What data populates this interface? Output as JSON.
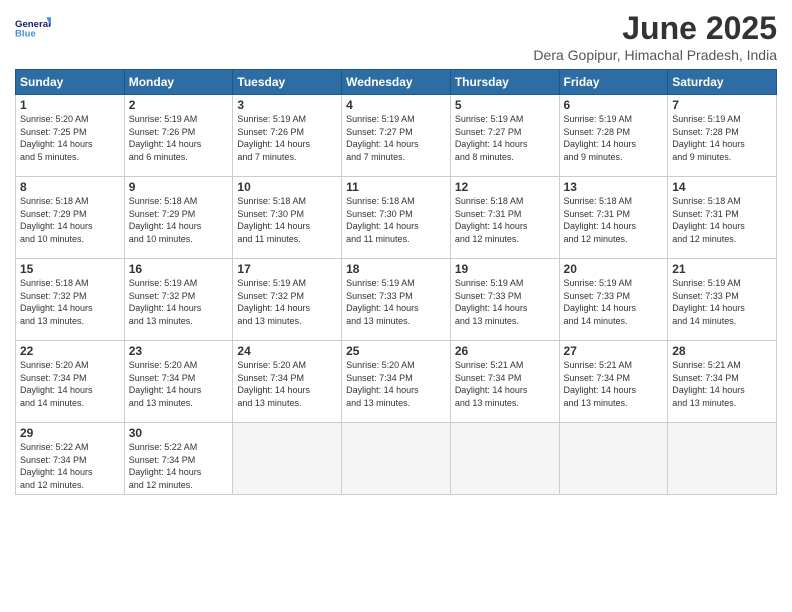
{
  "logo": {
    "line1": "General",
    "line2": "Blue"
  },
  "title": "June 2025",
  "subtitle": "Dera Gopipur, Himachal Pradesh, India",
  "weekdays": [
    "Sunday",
    "Monday",
    "Tuesday",
    "Wednesday",
    "Thursday",
    "Friday",
    "Saturday"
  ],
  "weeks": [
    [
      {
        "day": 1,
        "info": "Sunrise: 5:20 AM\nSunset: 7:25 PM\nDaylight: 14 hours\nand 5 minutes."
      },
      {
        "day": 2,
        "info": "Sunrise: 5:19 AM\nSunset: 7:26 PM\nDaylight: 14 hours\nand 6 minutes."
      },
      {
        "day": 3,
        "info": "Sunrise: 5:19 AM\nSunset: 7:26 PM\nDaylight: 14 hours\nand 7 minutes."
      },
      {
        "day": 4,
        "info": "Sunrise: 5:19 AM\nSunset: 7:27 PM\nDaylight: 14 hours\nand 7 minutes."
      },
      {
        "day": 5,
        "info": "Sunrise: 5:19 AM\nSunset: 7:27 PM\nDaylight: 14 hours\nand 8 minutes."
      },
      {
        "day": 6,
        "info": "Sunrise: 5:19 AM\nSunset: 7:28 PM\nDaylight: 14 hours\nand 9 minutes."
      },
      {
        "day": 7,
        "info": "Sunrise: 5:19 AM\nSunset: 7:28 PM\nDaylight: 14 hours\nand 9 minutes."
      }
    ],
    [
      {
        "day": 8,
        "info": "Sunrise: 5:18 AM\nSunset: 7:29 PM\nDaylight: 14 hours\nand 10 minutes."
      },
      {
        "day": 9,
        "info": "Sunrise: 5:18 AM\nSunset: 7:29 PM\nDaylight: 14 hours\nand 10 minutes."
      },
      {
        "day": 10,
        "info": "Sunrise: 5:18 AM\nSunset: 7:30 PM\nDaylight: 14 hours\nand 11 minutes."
      },
      {
        "day": 11,
        "info": "Sunrise: 5:18 AM\nSunset: 7:30 PM\nDaylight: 14 hours\nand 11 minutes."
      },
      {
        "day": 12,
        "info": "Sunrise: 5:18 AM\nSunset: 7:31 PM\nDaylight: 14 hours\nand 12 minutes."
      },
      {
        "day": 13,
        "info": "Sunrise: 5:18 AM\nSunset: 7:31 PM\nDaylight: 14 hours\nand 12 minutes."
      },
      {
        "day": 14,
        "info": "Sunrise: 5:18 AM\nSunset: 7:31 PM\nDaylight: 14 hours\nand 12 minutes."
      }
    ],
    [
      {
        "day": 15,
        "info": "Sunrise: 5:18 AM\nSunset: 7:32 PM\nDaylight: 14 hours\nand 13 minutes."
      },
      {
        "day": 16,
        "info": "Sunrise: 5:19 AM\nSunset: 7:32 PM\nDaylight: 14 hours\nand 13 minutes."
      },
      {
        "day": 17,
        "info": "Sunrise: 5:19 AM\nSunset: 7:32 PM\nDaylight: 14 hours\nand 13 minutes."
      },
      {
        "day": 18,
        "info": "Sunrise: 5:19 AM\nSunset: 7:33 PM\nDaylight: 14 hours\nand 13 minutes."
      },
      {
        "day": 19,
        "info": "Sunrise: 5:19 AM\nSunset: 7:33 PM\nDaylight: 14 hours\nand 13 minutes."
      },
      {
        "day": 20,
        "info": "Sunrise: 5:19 AM\nSunset: 7:33 PM\nDaylight: 14 hours\nand 14 minutes."
      },
      {
        "day": 21,
        "info": "Sunrise: 5:19 AM\nSunset: 7:33 PM\nDaylight: 14 hours\nand 14 minutes."
      }
    ],
    [
      {
        "day": 22,
        "info": "Sunrise: 5:20 AM\nSunset: 7:34 PM\nDaylight: 14 hours\nand 14 minutes."
      },
      {
        "day": 23,
        "info": "Sunrise: 5:20 AM\nSunset: 7:34 PM\nDaylight: 14 hours\nand 13 minutes."
      },
      {
        "day": 24,
        "info": "Sunrise: 5:20 AM\nSunset: 7:34 PM\nDaylight: 14 hours\nand 13 minutes."
      },
      {
        "day": 25,
        "info": "Sunrise: 5:20 AM\nSunset: 7:34 PM\nDaylight: 14 hours\nand 13 minutes."
      },
      {
        "day": 26,
        "info": "Sunrise: 5:21 AM\nSunset: 7:34 PM\nDaylight: 14 hours\nand 13 minutes."
      },
      {
        "day": 27,
        "info": "Sunrise: 5:21 AM\nSunset: 7:34 PM\nDaylight: 14 hours\nand 13 minutes."
      },
      {
        "day": 28,
        "info": "Sunrise: 5:21 AM\nSunset: 7:34 PM\nDaylight: 14 hours\nand 13 minutes."
      }
    ],
    [
      {
        "day": 29,
        "info": "Sunrise: 5:22 AM\nSunset: 7:34 PM\nDaylight: 14 hours\nand 12 minutes."
      },
      {
        "day": 30,
        "info": "Sunrise: 5:22 AM\nSunset: 7:34 PM\nDaylight: 14 hours\nand 12 minutes."
      },
      null,
      null,
      null,
      null,
      null
    ]
  ]
}
